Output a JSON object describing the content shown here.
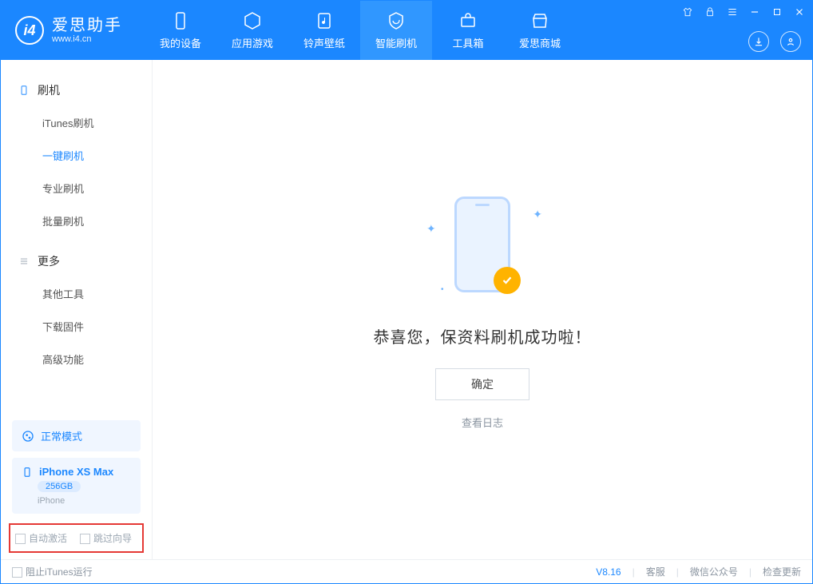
{
  "app": {
    "title": "爱思助手",
    "subtitle": "www.i4.cn"
  },
  "nav": {
    "items": [
      {
        "label": "我的设备"
      },
      {
        "label": "应用游戏"
      },
      {
        "label": "铃声壁纸"
      },
      {
        "label": "智能刷机"
      },
      {
        "label": "工具箱"
      },
      {
        "label": "爱思商城"
      }
    ]
  },
  "sidebar": {
    "group1": {
      "label": "刷机"
    },
    "items1": [
      {
        "label": "iTunes刷机"
      },
      {
        "label": "一键刷机"
      },
      {
        "label": "专业刷机"
      },
      {
        "label": "批量刷机"
      }
    ],
    "group2": {
      "label": "更多"
    },
    "items2": [
      {
        "label": "其他工具"
      },
      {
        "label": "下载固件"
      },
      {
        "label": "高级功能"
      }
    ]
  },
  "mode": {
    "label": "正常模式"
  },
  "device": {
    "name": "iPhone XS Max",
    "storage": "256GB",
    "type": "iPhone"
  },
  "options": {
    "auto_activate": "自动激活",
    "skip_guide": "跳过向导"
  },
  "main": {
    "success_text": "恭喜您，保资料刷机成功啦！",
    "ok_btn": "确定",
    "log_link": "查看日志"
  },
  "statusbar": {
    "block_itunes": "阻止iTunes运行",
    "version": "V8.16",
    "support": "客服",
    "wechat": "微信公众号",
    "check_update": "检查更新"
  }
}
